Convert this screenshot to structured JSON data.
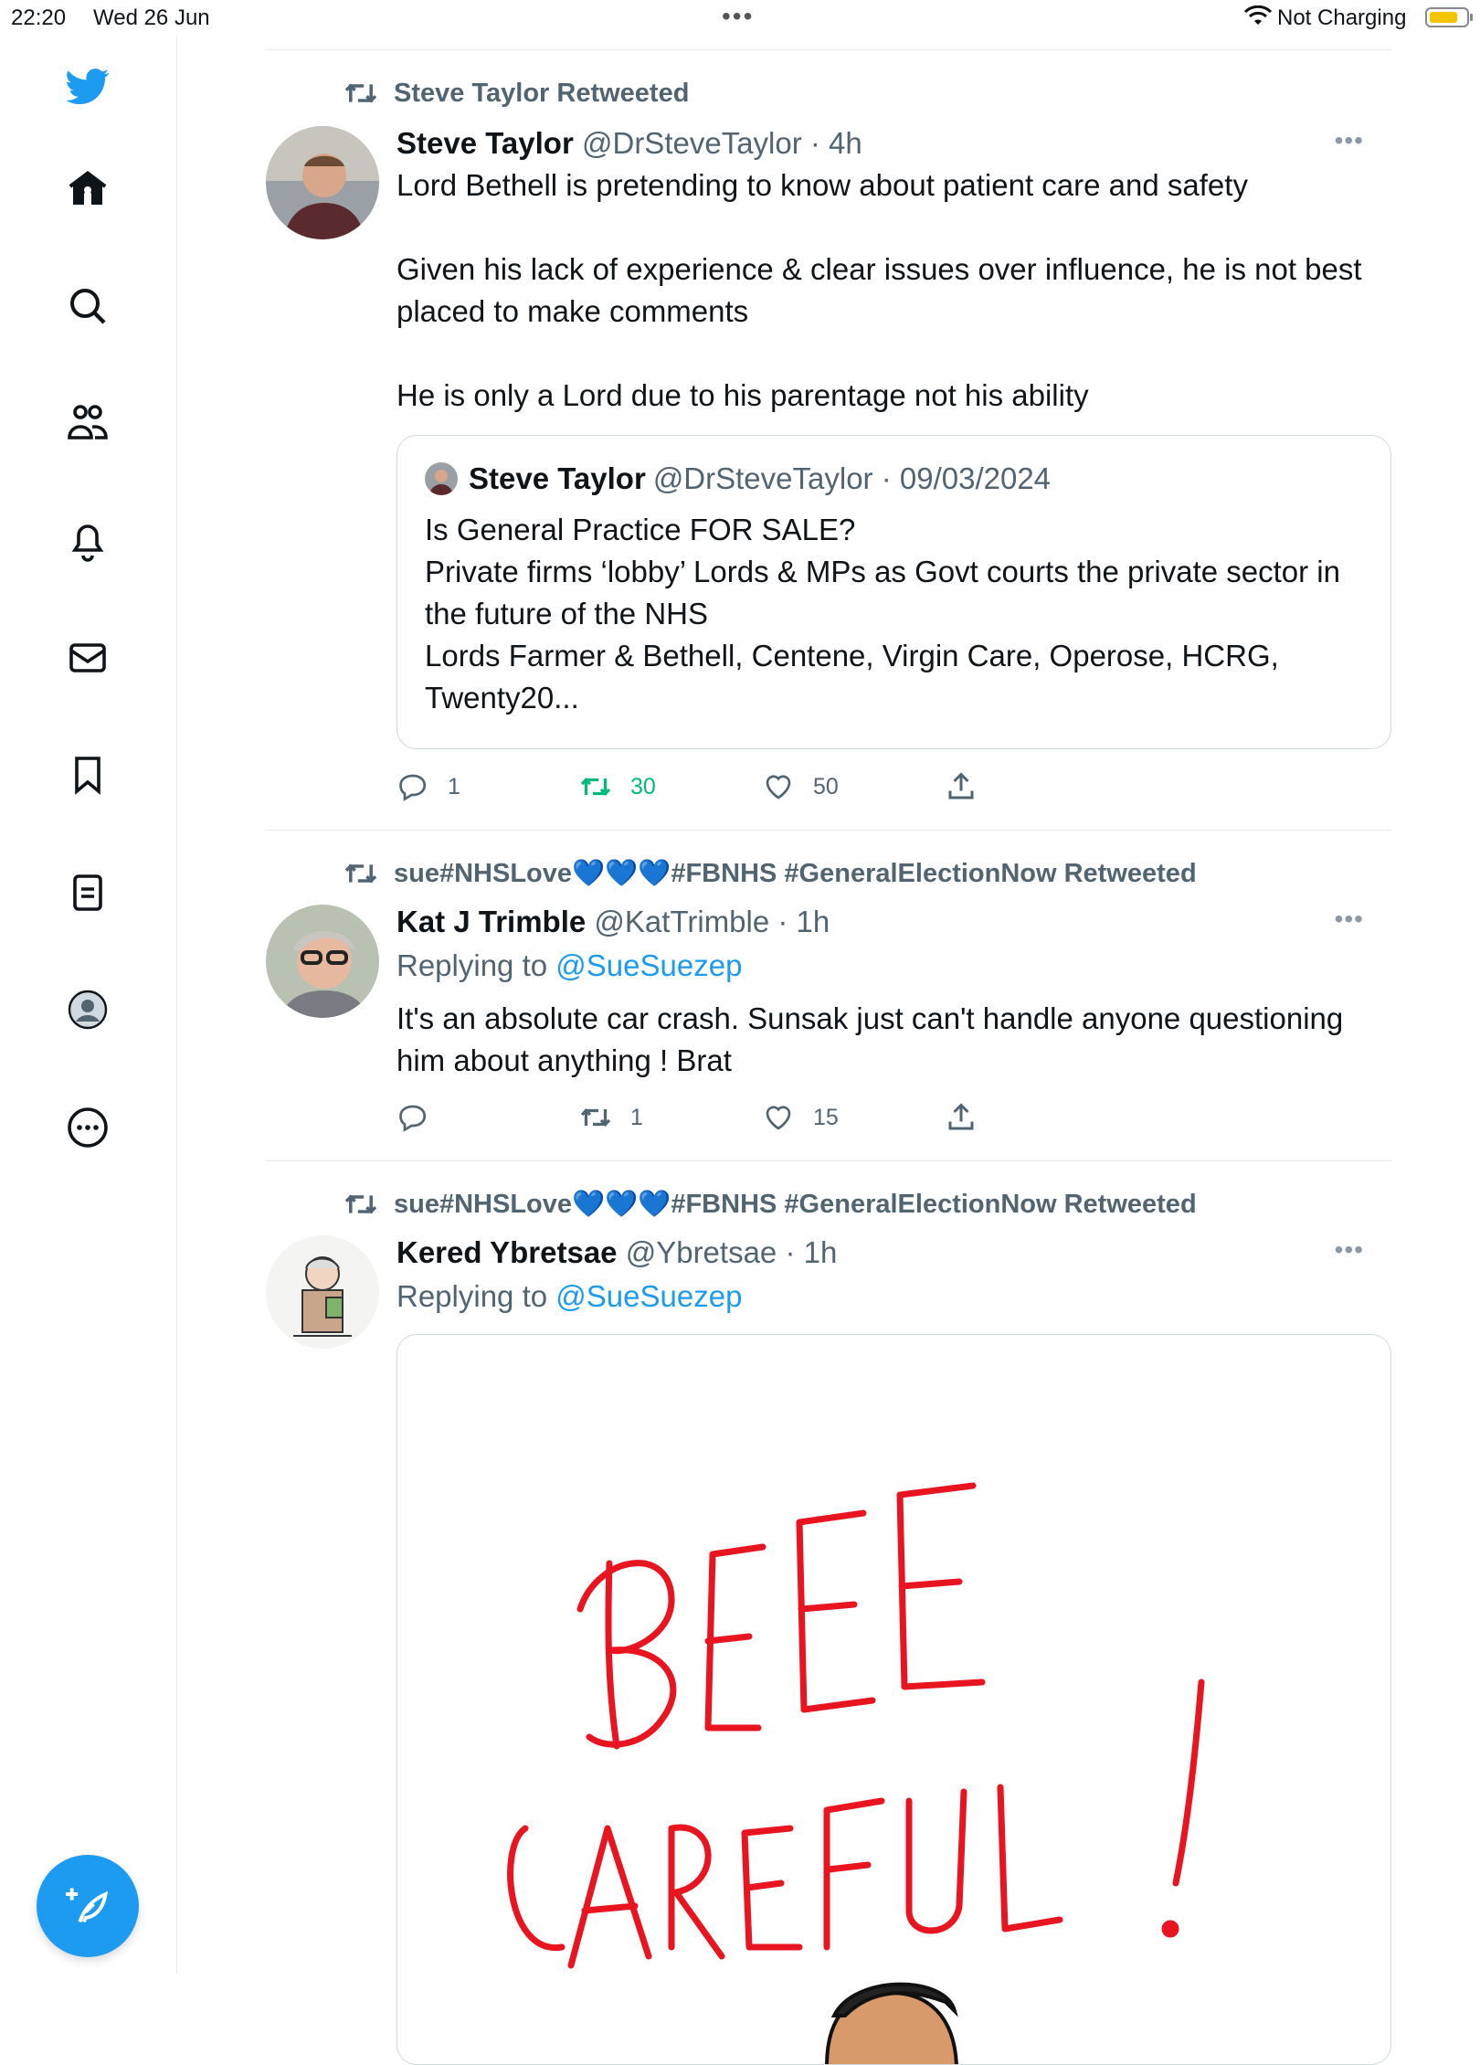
{
  "status_bar": {
    "time": "22:20",
    "date": "Wed 26 Jun",
    "charging": "Not Charging"
  },
  "sidebar": {
    "items": [
      {
        "icon": "twitter-logo-icon"
      },
      {
        "icon": "home-icon"
      },
      {
        "icon": "search-icon"
      },
      {
        "icon": "communities-icon"
      },
      {
        "icon": "notifications-icon"
      },
      {
        "icon": "messages-icon"
      },
      {
        "icon": "bookmarks-icon"
      },
      {
        "icon": "lists-icon"
      },
      {
        "icon": "profile-icon"
      },
      {
        "icon": "more-icon"
      }
    ],
    "compose_icon": "compose-tweet-icon"
  },
  "colors": {
    "accent": "#1d9bf0",
    "retweet_green": "#00ba7c",
    "secondary_text": "#536471",
    "divider": "#e6ecf0"
  },
  "tweets": [
    {
      "retweeted_by": "Steve Taylor Retweeted",
      "name": "Steve Taylor",
      "meta": "@DrSteveTaylor · 4h",
      "text": "Lord Bethell is pretending to know about patient care and safety\n\nGiven his lack of experience & clear issues over influence, he is not best placed to make comments\n\nHe is only a Lord due to his parentage not his ability",
      "quote": {
        "name": "Steve Taylor",
        "meta": "@DrSteveTaylor · 09/03/2024",
        "text": "Is General Practice FOR SALE?\nPrivate firms ‘lobby’ Lords & MPs as Govt courts the private sector in the future of the NHS\nLords Farmer & Bethell, Centene, Virgin Care, Operose, HCRG, Twenty20..."
      },
      "actions": {
        "replies": "1",
        "retweets": "30",
        "likes": "50"
      }
    },
    {
      "retweeted_by": "sue#NHSLove💙💙💙#FBNHS #GeneralElectionNow Retweeted",
      "name": "Kat J Trimble",
      "meta": "@KatTrimble · 1h",
      "replying_prefix": "Replying to",
      "replying_handle": "@SueSuezep",
      "text": "It's an absolute car crash. Sunsak just can't handle anyone questioning him about anything ! Brat",
      "actions": {
        "replies": "",
        "retweets": "1",
        "likes": "15"
      }
    },
    {
      "retweeted_by": "sue#NHSLove💙💙💙#FBNHS #GeneralElectionNow Retweeted",
      "name": "Kered Ybretsae",
      "meta": "@Ybretsae · 1h",
      "replying_prefix": "Replying to",
      "replying_handle": "@SueSuezep",
      "media_text_line1": "BEEE",
      "media_text_line2": "CAREFUL!"
    }
  ]
}
